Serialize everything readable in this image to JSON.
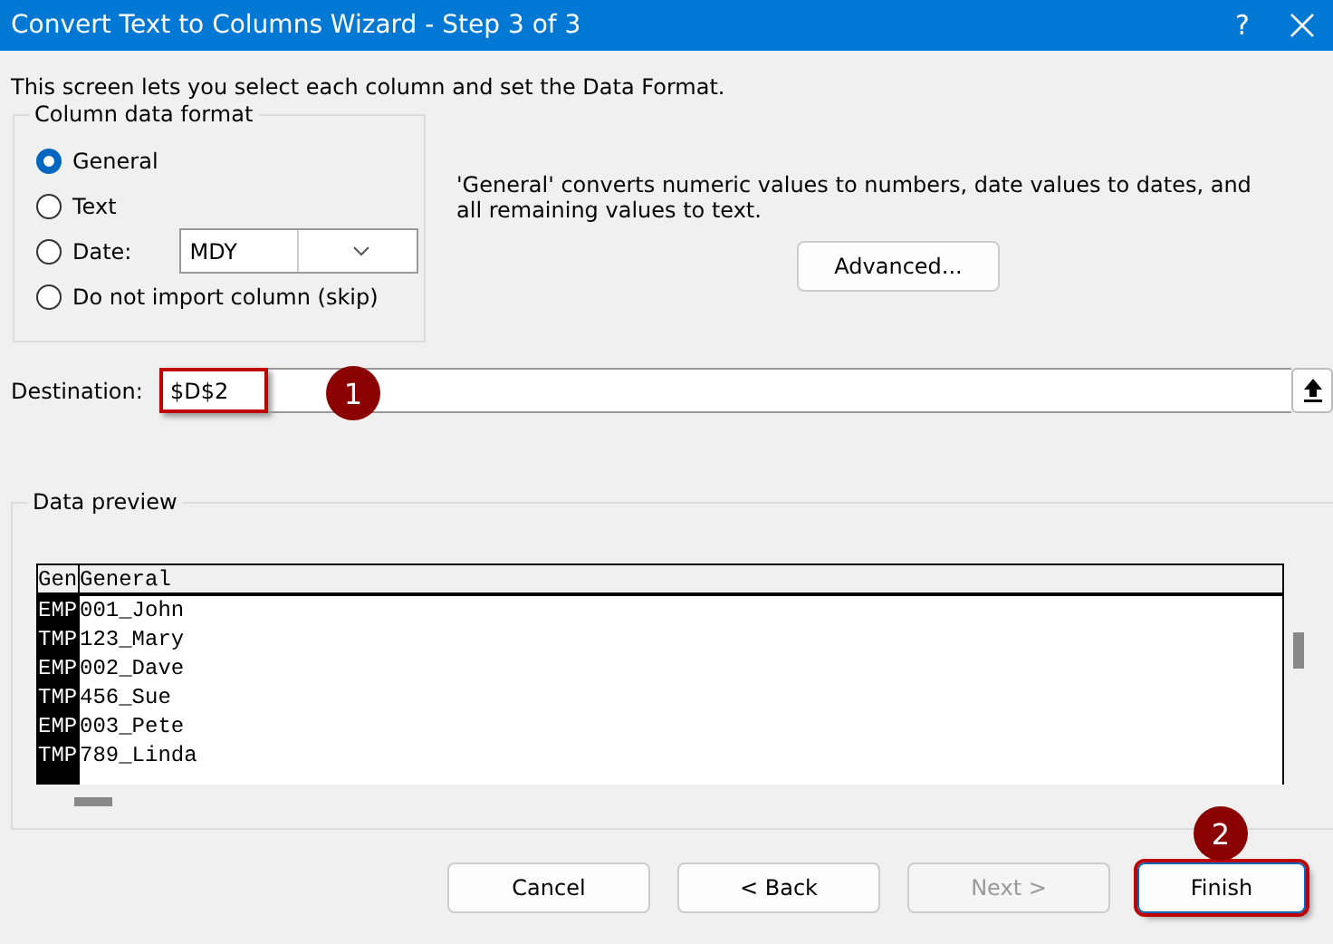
{
  "window": {
    "title": "Convert Text to Columns Wizard - Step 3 of 3",
    "help": "?"
  },
  "intro": "This screen lets you select each column and set the Data Format.",
  "column_data_format": {
    "legend": "Column data format",
    "options": [
      {
        "label": "General",
        "selected": true
      },
      {
        "label": "Text",
        "selected": false
      },
      {
        "label": "Date:",
        "selected": false,
        "dropdown": "MDY"
      },
      {
        "label": "Do not import column (skip)",
        "selected": false
      }
    ]
  },
  "description": "'General' converts numeric values to numbers, date values to dates, and all remaining values to text.",
  "advanced_button": "Advanced...",
  "destination": {
    "label": "Destination:",
    "value": "$D$2",
    "highlighted": true,
    "callout": "1"
  },
  "data_preview": {
    "legend": "Data preview",
    "columns": [
      {
        "header": "Gen",
        "selected": true
      },
      {
        "header": "General",
        "selected": false
      }
    ],
    "rows": [
      [
        "EMP",
        "001_John"
      ],
      [
        "TMP",
        "123_Mary"
      ],
      [
        "EMP",
        "002_Dave"
      ],
      [
        "TMP",
        "456_Sue"
      ],
      [
        "EMP",
        "003_Pete"
      ],
      [
        "TMP",
        "789_Linda"
      ]
    ]
  },
  "buttons": [
    {
      "label": "Cancel",
      "disabled": false,
      "highlighted": false
    },
    {
      "label": "< Back",
      "disabled": false,
      "highlighted": false
    },
    {
      "label": "Next >",
      "disabled": true,
      "highlighted": false
    },
    {
      "label": "Finish",
      "disabled": false,
      "highlighted": true,
      "callout": "2"
    }
  ]
}
